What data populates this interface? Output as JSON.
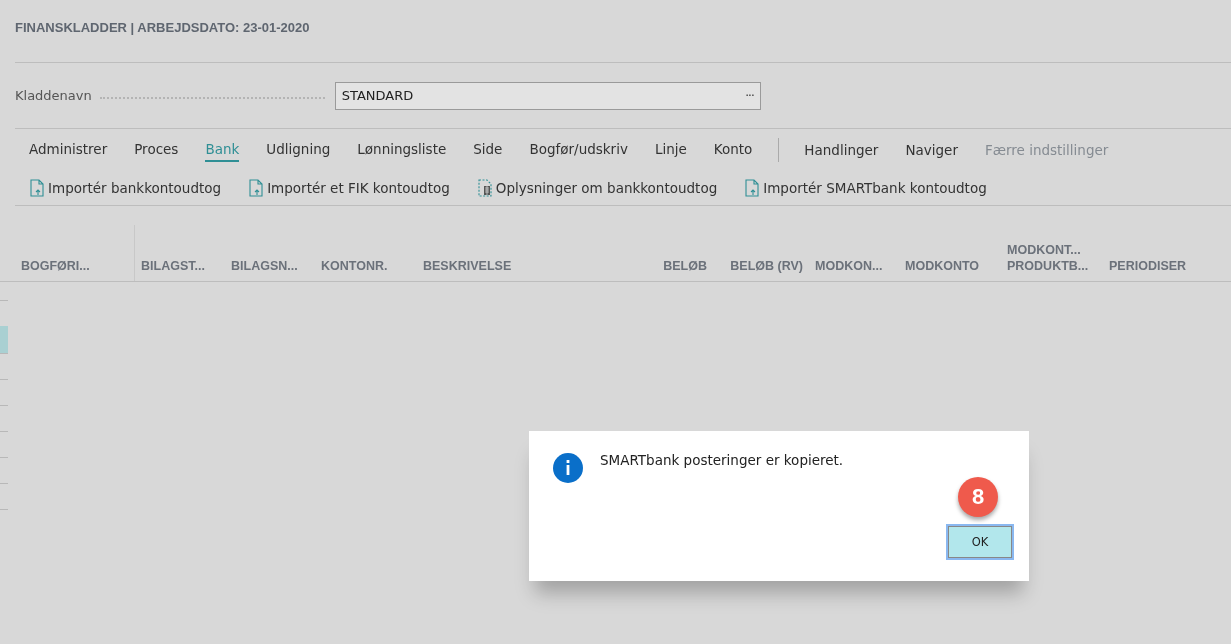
{
  "page": {
    "title": "FINANSKLADDER | ARBEJDSDATO: 23-01-2020"
  },
  "journal_field": {
    "label": "Kladdenavn",
    "value": "STANDARD",
    "lookup": "···"
  },
  "tabs": [
    {
      "label": "Administrer",
      "selected": false
    },
    {
      "label": "Proces",
      "selected": false
    },
    {
      "label": "Bank",
      "selected": true
    },
    {
      "label": "Udligning",
      "selected": false
    },
    {
      "label": "Lønningsliste",
      "selected": false
    },
    {
      "label": "Side",
      "selected": false
    },
    {
      "label": "Bogfør/udskriv",
      "selected": false
    },
    {
      "label": "Linje",
      "selected": false
    },
    {
      "label": "Konto",
      "selected": false
    }
  ],
  "menus": [
    {
      "label": "Handlinger",
      "disabled": false
    },
    {
      "label": "Naviger",
      "disabled": false
    },
    {
      "label": "Færre indstillinger",
      "disabled": true
    }
  ],
  "actions": [
    {
      "label": "Importér bankkontoudtog",
      "kind": "import"
    },
    {
      "label": "Importér et FIK kontoudtog",
      "kind": "import"
    },
    {
      "label": "Oplysninger om bankkontoudtog",
      "kind": "details"
    },
    {
      "label": "Importér SMARTbank kontoudtog",
      "kind": "import"
    }
  ],
  "table": {
    "columns": [
      "BOGFØRI...",
      "BILAGST...",
      "BILAGSN...",
      "KONTONR.",
      "BESKRIVELSE",
      "BELØB",
      "BELØB (RV)",
      "MODKON...",
      "MODKONTO",
      "MODKONT... PRODUKTB...",
      "PERIODISER"
    ]
  },
  "dialog": {
    "message": "SMARTbank posteringer er kopieret.",
    "button": "OK",
    "step_badge": "8"
  }
}
